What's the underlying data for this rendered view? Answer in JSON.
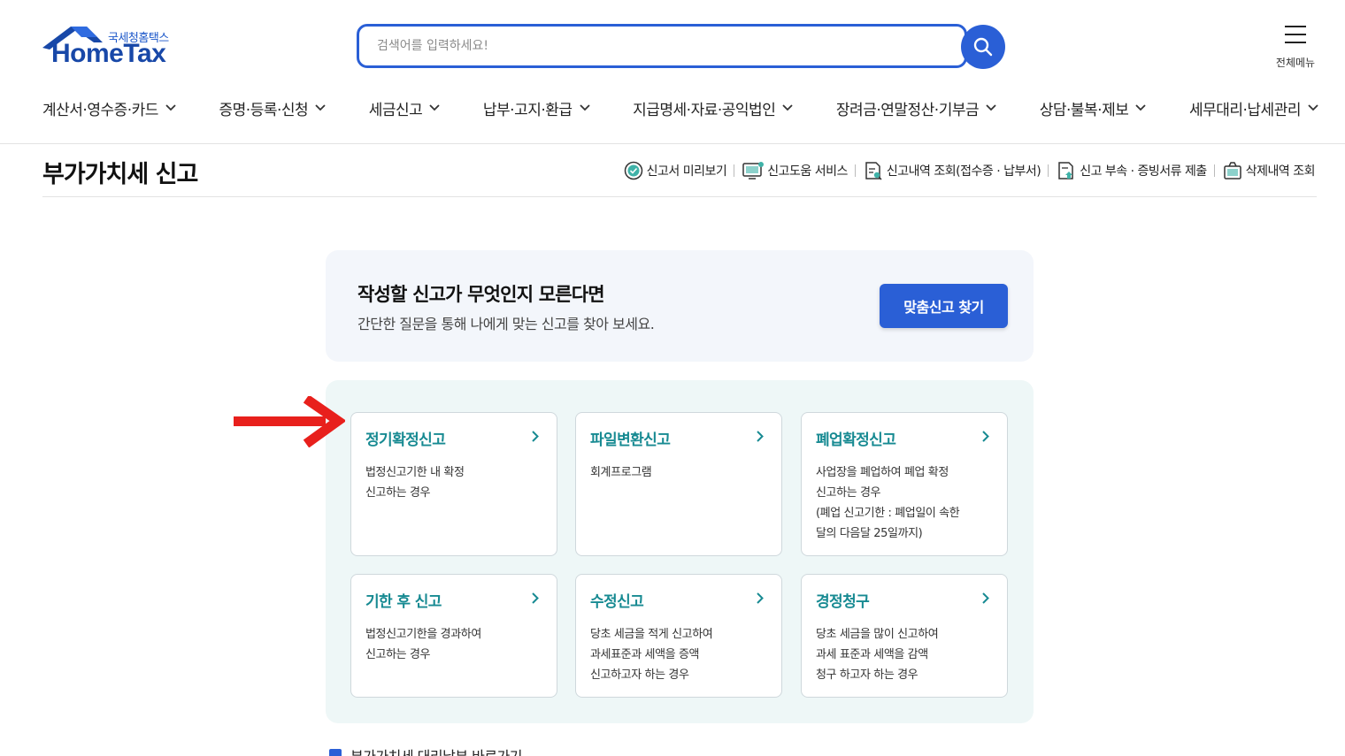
{
  "header": {
    "logo_sub": "국세청홈택스",
    "logo_main": "HomeTax",
    "search_placeholder": "검색어를 입력하세요!",
    "all_menu_label": "전체메뉴"
  },
  "gnb": [
    {
      "label": "계산서·영수증·카드"
    },
    {
      "label": "증명·등록·신청"
    },
    {
      "label": "세금신고"
    },
    {
      "label": "납부·고지·환급"
    },
    {
      "label": "지급명세·자료·공익법인"
    },
    {
      "label": "장려금·연말정산·기부금"
    },
    {
      "label": "상담·불복·제보"
    },
    {
      "label": "세무대리·납세관리"
    }
  ],
  "page": {
    "title": "부가가치세 신고",
    "utils": [
      {
        "label": "신고서 미리보기",
        "icon": "check-circle-icon"
      },
      {
        "label": "신고도움 서비스",
        "icon": "monitor-help-icon"
      },
      {
        "label": "신고내역 조회(접수증 · 납부서)",
        "icon": "document-search-icon"
      },
      {
        "label": "신고 부속 · 증빙서류 제출",
        "icon": "document-upload-icon"
      },
      {
        "label": "삭제내역 조회",
        "icon": "trash-basket-icon"
      }
    ]
  },
  "promo": {
    "heading": "작성할 신고가 무엇인지 모른다면",
    "text": "간단한 질문을 통해 나에게 맞는 신고를 찾아 보세요.",
    "button": "맞춤신고 찾기"
  },
  "cards": [
    {
      "title": "정기확정신고",
      "desc": "법정신고기한 내 확정\n신고하는 경우"
    },
    {
      "title": "파일변환신고",
      "desc": "회계프로그램"
    },
    {
      "title": "폐업확정신고",
      "desc": "사업장을 폐업하여 폐업 확정\n신고하는 경우\n(폐업 신고기한 : 폐업일이 속한\n달의 다음달 25일까지)"
    },
    {
      "title": "기한 후 신고",
      "desc": "법정신고기한을 경과하여\n신고하는 경우"
    },
    {
      "title": "수정신고",
      "desc": "당초 세금을 적게 신고하여\n과세표준과 세액을 증액\n신고하고자 하는 경우"
    },
    {
      "title": "경정청구",
      "desc": "당초 세금을 많이 신고하여\n과세 표준과 세액을 감액\n청구 하고자 하는 경우"
    }
  ],
  "bottom_link": "부가가치세 대리납부 바로가기",
  "colors": {
    "accent": "#2a5fd6",
    "card_title": "#178a92",
    "arrow": "#e8201c"
  }
}
